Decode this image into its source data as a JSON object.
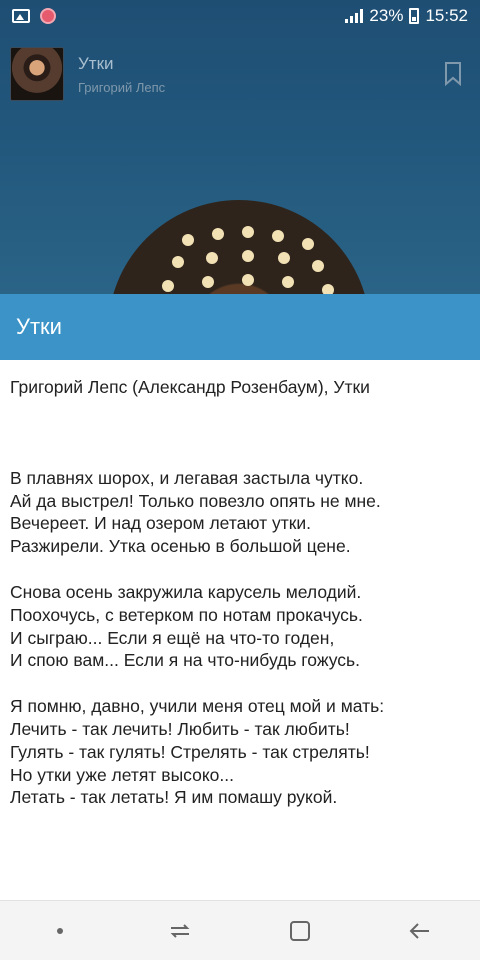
{
  "status_bar": {
    "battery": "23%",
    "time": "15:52",
    "icons": [
      "image-icon",
      "app-notification-icon",
      "signal-icon",
      "battery-icon"
    ]
  },
  "player": {
    "title": "Утки",
    "artist": "Григорий Лепс",
    "icons": [
      "album-cover",
      "bookmark-icon"
    ]
  },
  "dialog": {
    "title": "Утки",
    "heading": "Григорий Лепс (Александр Розенбаум), Утки",
    "stanzas": [
      {
        "lines": [
          "В плавнях шорох, и легавая застыла чутко.",
          "Ай да выстрел! Только повезло опять не мне.",
          "Вечереет. И над озером летают утки.",
          "Разжирели. Утка осенью в большой цене."
        ]
      },
      {
        "lines": [
          "Снова осень закружила карусель мелодий.",
          "Поохочусь, с ветерком по нотам прокачусь.",
          "И сыграю... Если я ещё на что-то годен,",
          "И спою вам... Если я на что-нибудь гожусь."
        ]
      },
      {
        "lines": [
          "Я помню, давно, учили меня отец мой и мать:",
          "Лечить - так лечить! Любить - так любить!",
          "Гулять - так гулять! Стрелять - так стрелять!",
          "Но утки уже летят высоко...",
          "Летать - так летать! Я им помашу рукой."
        ]
      }
    ]
  },
  "nav_bar": {
    "icons": [
      "dot-icon",
      "recent-apps-icon",
      "home-icon",
      "back-icon"
    ]
  },
  "colors": {
    "dialog_header": "#3b93c8",
    "player_bg": "#22577c"
  }
}
